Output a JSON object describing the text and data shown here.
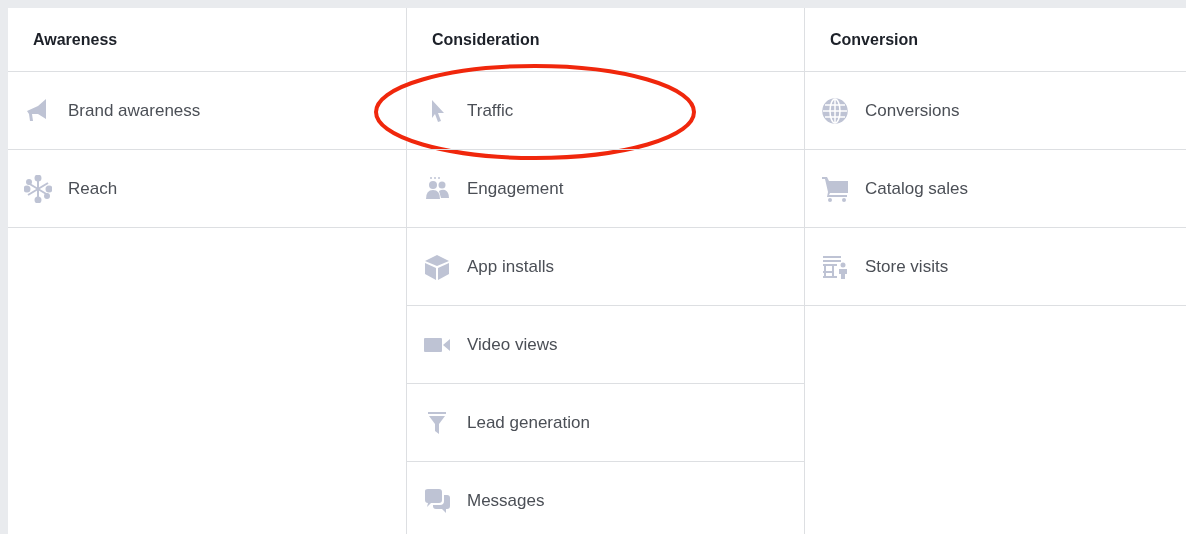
{
  "columns": [
    {
      "title": "Awareness",
      "options": [
        {
          "label": "Brand awareness",
          "highlighted": false
        },
        {
          "label": "Reach",
          "highlighted": false
        }
      ]
    },
    {
      "title": "Consideration",
      "options": [
        {
          "label": "Traffic",
          "highlighted": true
        },
        {
          "label": "Engagement",
          "highlighted": false
        },
        {
          "label": "App installs",
          "highlighted": false
        },
        {
          "label": "Video views",
          "highlighted": false
        },
        {
          "label": "Lead generation",
          "highlighted": false
        },
        {
          "label": "Messages",
          "highlighted": false
        }
      ]
    },
    {
      "title": "Conversion",
      "options": [
        {
          "label": "Conversions",
          "highlighted": false
        },
        {
          "label": "Catalog sales",
          "highlighted": false
        },
        {
          "label": "Store visits",
          "highlighted": false
        }
      ]
    }
  ]
}
